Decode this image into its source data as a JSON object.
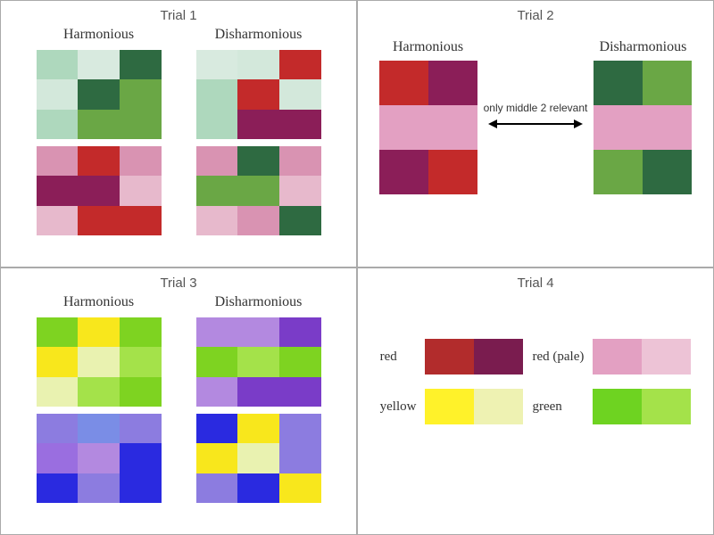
{
  "trials": {
    "t1": {
      "title": "Trial 1",
      "labels": {
        "h": "Harmonious",
        "d": "Disharmonious"
      },
      "grids": {
        "top_h": [
          "#aed8bd",
          "#d8eadf",
          "#2e6a41",
          "#d3e8db",
          "#2e6a41",
          "#6aa745",
          "#aed8bd",
          "#6aa745",
          "#6aa745"
        ],
        "top_d": [
          "#d8eadf",
          "#d3e8db",
          "#c32a2a",
          "#aed8bd",
          "#c32a2a",
          "#d3e8db",
          "#aed8bd",
          "#8b1e58",
          "#8b1e58"
        ],
        "bot_h": [
          "#d993b2",
          "#c32a2a",
          "#d993b2",
          "#8b1e58",
          "#8b1e58",
          "#e7b9cc",
          "#e7b9cc",
          "#c32a2a",
          "#c32a2a"
        ],
        "bot_d": [
          "#d993b2",
          "#2e6a41",
          "#d993b2",
          "#6aa745",
          "#6aa745",
          "#e7b9cc",
          "#e7b9cc",
          "#d993b2",
          "#2e6a41"
        ]
      }
    },
    "t2": {
      "title": "Trial 2",
      "labels": {
        "h": "Harmonious",
        "d": "Disharmonious"
      },
      "mid_text": "only middle 2 relevant",
      "grids": {
        "h": [
          "#c32a2a",
          "#8b1e58",
          "#e3a0c2",
          "#e3a0c2",
          "#8b1e58",
          "#c32a2a"
        ],
        "d": [
          "#2e6a41",
          "#6aa745",
          "#e3a0c2",
          "#e3a0c2",
          "#6aa745",
          "#2e6a41"
        ]
      }
    },
    "t3": {
      "title": "Trial 3",
      "labels": {
        "h": "Harmonious",
        "d": "Disharmonious"
      },
      "grids": {
        "top_h": [
          "#7ed321",
          "#f8e71c",
          "#7ed321",
          "#f8e71c",
          "#e9f2b0",
          "#a4e24a",
          "#e9f2b0",
          "#a4e24a",
          "#7ed321"
        ],
        "top_d": [
          "#b389e0",
          "#b389e0",
          "#7a3cc8",
          "#7ed321",
          "#a4e24a",
          "#7ed321",
          "#b389e0",
          "#7a3cc8",
          "#7a3cc8"
        ],
        "bot_h": [
          "#8c7ce0",
          "#7a8de6",
          "#8c7ce0",
          "#9a6ee0",
          "#b389e0",
          "#2a2ae0",
          "#2a2ae0",
          "#8c7ce0",
          "#2a2ae0"
        ],
        "bot_d": [
          "#2a2ae0",
          "#f8e71c",
          "#8c7ce0",
          "#f8e71c",
          "#e9f2b0",
          "#8c7ce0",
          "#8c7ce0",
          "#2a2ae0",
          "#f8e71c"
        ]
      }
    },
    "t4": {
      "title": "Trial 4",
      "items": [
        {
          "label": "red",
          "colors": [
            "#b22c2c",
            "#7a1c4f"
          ]
        },
        {
          "label": "red (pale)",
          "colors": [
            "#e3a0c2",
            "#edc3d6"
          ]
        },
        {
          "label": "yellow",
          "colors": [
            "#fff22a",
            "#eef2b2"
          ]
        },
        {
          "label": "green",
          "colors": [
            "#6ed321",
            "#a4e24a"
          ]
        }
      ]
    }
  },
  "chart_data": {
    "type": "table",
    "description": "Four trial panels of color-harmony swatch grids",
    "trials": [
      {
        "id": 1,
        "layout": "two 3x3 grids (Harmonious/Disharmonious) × two rows"
      },
      {
        "id": 2,
        "layout": "two 2x3 grids with note that only middle 2 rows are relevant"
      },
      {
        "id": 3,
        "layout": "two 3x3 grids (Harmonious/Disharmonious) × two rows"
      },
      {
        "id": 4,
        "layout": "four labeled color pairs: red, red (pale), yellow, green"
      }
    ]
  }
}
